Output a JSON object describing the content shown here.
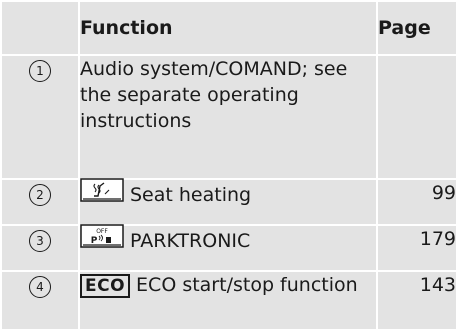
{
  "header": {
    "number_col": "",
    "function_col": "Function",
    "page_col": "Page"
  },
  "rows": [
    {
      "num": "1",
      "function": "Audio system/COMAND; see the separate operating instructions",
      "page": ""
    },
    {
      "num": "2",
      "icon": "seat-heating-button-icon",
      "function": "Seat heating",
      "page": "99"
    },
    {
      "num": "3",
      "icon": "parktronic-off-button-icon",
      "icon_text": "OFF",
      "function": "PARKTRONIC",
      "page": "179"
    },
    {
      "num": "4",
      "icon": "eco-button-icon",
      "icon_text": "ECO",
      "function": "ECO start/stop function",
      "page": "143"
    }
  ],
  "colors": {
    "cell_background": "#e3e3e3",
    "grid_lines": "#ffffff",
    "text": "#1a1a1a"
  }
}
